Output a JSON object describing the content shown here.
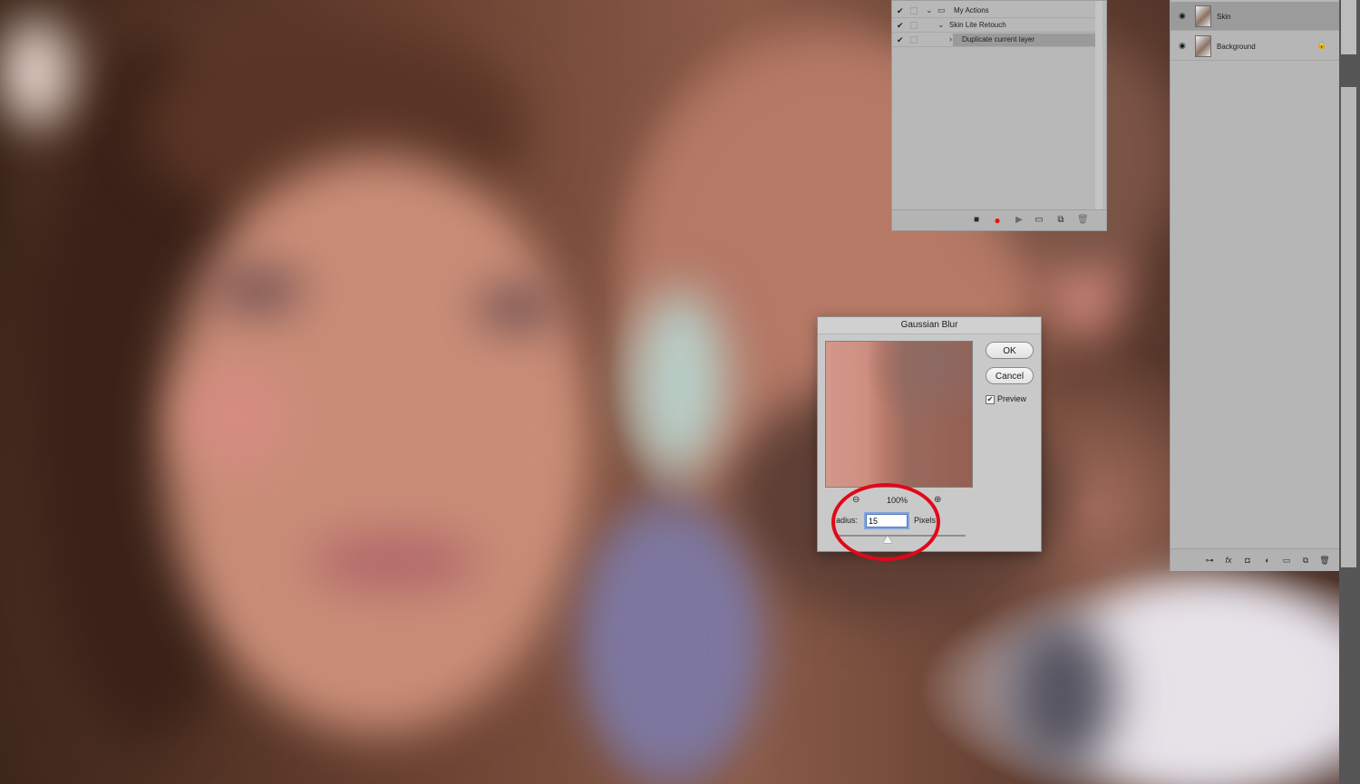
{
  "actions_panel": {
    "rows": [
      {
        "label": "My Actions",
        "checked": true,
        "expanded": true,
        "is_folder": true
      },
      {
        "label": "Skin Lite Retouch",
        "checked": true,
        "expanded": true
      },
      {
        "label": "Duplicate current layer",
        "checked": true,
        "expanded": false,
        "selected": true
      }
    ],
    "footer_icons": [
      "stop-icon",
      "record-icon",
      "play-icon",
      "folder-icon",
      "new-action-icon",
      "trash-icon"
    ],
    "record_color": "#e0161a"
  },
  "layers_panel": {
    "layers": [
      {
        "name": "Skin",
        "visible": true,
        "active": true,
        "locked": false
      },
      {
        "name": "Background",
        "visible": true,
        "active": false,
        "locked": true
      }
    ],
    "footer_icons": [
      "link-icon",
      "fx-icon",
      "mask-icon",
      "adjustment-icon",
      "group-icon",
      "new-layer-icon",
      "trash-icon"
    ]
  },
  "dialog": {
    "title": "Gaussian Blur",
    "ok_label": "OK",
    "cancel_label": "Cancel",
    "preview_label": "Preview",
    "preview_checked": true,
    "zoom": "100%",
    "radius_label": "adius:",
    "radius_value": "15",
    "units_label": "Pixels"
  },
  "annotation": {
    "circle_color": "#e1081a"
  },
  "glyphs": {
    "check": "✔",
    "chevron_down": "⌄",
    "chevron_right": "›",
    "folder": "▭",
    "eye": "◉",
    "lock": "🔒",
    "zoom_out": "⊖",
    "zoom_in": "⊕",
    "stop": "■",
    "record": "●",
    "play": "▶",
    "trash": "🗑",
    "fx": "fx",
    "link": "⊶",
    "mask": "◘",
    "adjust": "◐",
    "group": "▭",
    "newlayer": "⧉"
  }
}
